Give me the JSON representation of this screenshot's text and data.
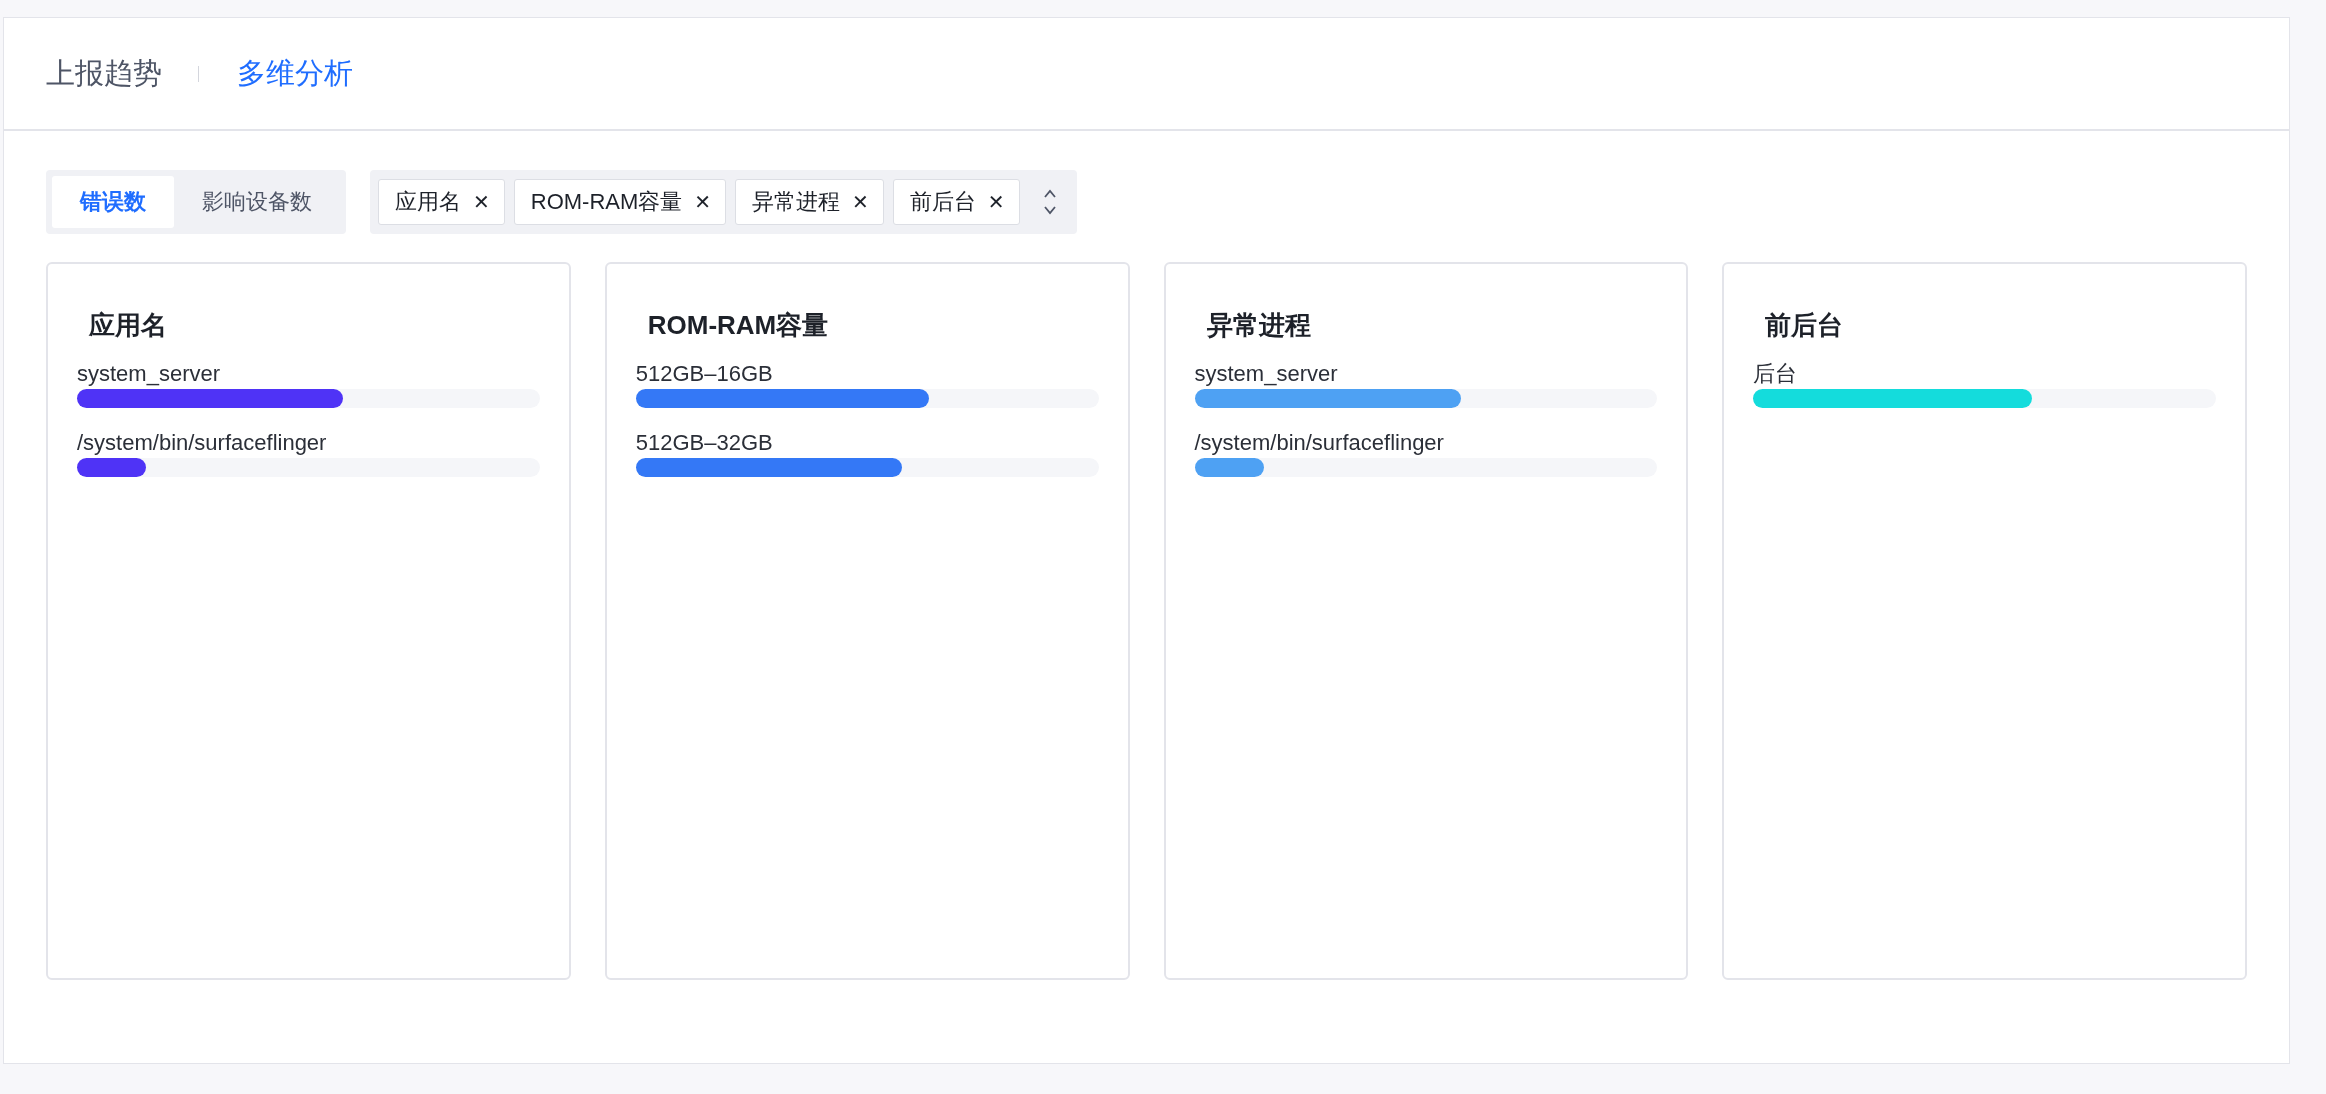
{
  "header_tabs": [
    {
      "label": "上报趋势",
      "selected": false
    },
    {
      "label": "多维分析",
      "selected": true
    }
  ],
  "metric_toggle": [
    {
      "label": "错误数",
      "selected": true
    },
    {
      "label": "影响设备数",
      "selected": false
    }
  ],
  "dimension_tags": [
    {
      "label": "应用名",
      "close": "✕"
    },
    {
      "label": "ROM-RAM容量",
      "close": "✕"
    },
    {
      "label": "异常进程",
      "close": "✕"
    },
    {
      "label": "前后台",
      "close": "✕"
    }
  ],
  "cards": [
    {
      "title": "应用名",
      "color": "#4f33f6",
      "items": [
        {
          "label": "system_server",
          "level": 0.575
        },
        {
          "label": "/system/bin/surfaceflinger",
          "level": 0.15
        }
      ]
    },
    {
      "title": "ROM-RAM容量",
      "color": "#3478f6",
      "items": [
        {
          "label": "512GB–16GB",
          "level": 0.633
        },
        {
          "label": "512GB–32GB",
          "level": 0.575
        }
      ]
    },
    {
      "title": "异常进程",
      "color": "#4ea1f3",
      "items": [
        {
          "label": "system_server",
          "level": 0.575
        },
        {
          "label": "/system/bin/surfaceflinger",
          "level": 0.15
        }
      ]
    },
    {
      "title": "前后台",
      "color": "#14dcdc",
      "items": [
        {
          "label": "后台",
          "level": 0.603
        }
      ]
    }
  ]
}
